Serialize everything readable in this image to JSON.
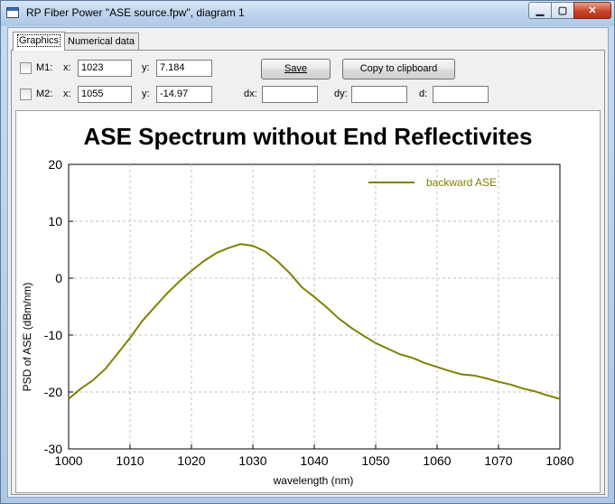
{
  "window": {
    "title": "RP Fiber Power \"ASE source.fpw\", diagram 1",
    "minimize_glyph": "▁",
    "maximize_glyph": "▢",
    "close_glyph": "✕",
    "icon": "app-window-icon"
  },
  "tabs": [
    {
      "label": "Graphics",
      "selected": true
    },
    {
      "label": "Numerical data",
      "selected": false
    }
  ],
  "markers": {
    "m1": {
      "label": "M1:",
      "checked": false,
      "x_label": "x:",
      "x_value": "1023",
      "y_label": "y:",
      "y_value": "7.184"
    },
    "m2": {
      "label": "M2:",
      "checked": false,
      "x_label": "x:",
      "x_value": "1055",
      "y_label": "y:",
      "y_value": "-14.97"
    }
  },
  "deltas": {
    "dx_label": "dx:",
    "dx_value": "",
    "dy_label": "dy:",
    "dy_value": "",
    "d_label": "d:",
    "d_value": ""
  },
  "buttons": {
    "save": "Save",
    "copy": "Copy to clipboard"
  },
  "colors": {
    "series": "#808000",
    "grid": "#c0c0c0"
  },
  "chart_data": {
    "type": "line",
    "title": "ASE Spectrum without End Reflectivites",
    "xlabel": "wavelength (nm)",
    "ylabel": "PSD of ASE (dBm/nm)",
    "xlim": [
      1000,
      1080
    ],
    "ylim": [
      -30,
      20
    ],
    "xticks": [
      1000,
      1010,
      1020,
      1030,
      1040,
      1050,
      1060,
      1070,
      1080
    ],
    "yticks": [
      -30,
      -20,
      -10,
      0,
      10,
      20
    ],
    "grid": true,
    "legend_position": "top-right",
    "series": [
      {
        "name": "backward ASE",
        "color": "#808000",
        "x": [
          1000,
          1002,
          1004,
          1006,
          1008,
          1010,
          1012,
          1014,
          1016,
          1018,
          1020,
          1022,
          1024,
          1026,
          1028,
          1030,
          1032,
          1034,
          1036,
          1038,
          1040,
          1042,
          1044,
          1046,
          1048,
          1050,
          1052,
          1054,
          1056,
          1058,
          1060,
          1062,
          1064,
          1066,
          1068,
          1070,
          1072,
          1074,
          1076,
          1078,
          1080
        ],
        "y": [
          -21.2,
          -19.4,
          -17.9,
          -15.9,
          -13.2,
          -10.5,
          -7.5,
          -5.1,
          -2.7,
          -0.6,
          1.3,
          3.0,
          4.4,
          5.3,
          6.0,
          5.7,
          4.7,
          3.0,
          0.9,
          -1.6,
          -3.3,
          -5.1,
          -7.1,
          -8.7,
          -10.1,
          -11.4,
          -12.4,
          -13.4,
          -14.0,
          -14.9,
          -15.6,
          -16.3,
          -16.9,
          -17.1,
          -17.6,
          -18.2,
          -18.7,
          -19.4,
          -19.9,
          -20.6,
          -21.2
        ]
      }
    ]
  }
}
